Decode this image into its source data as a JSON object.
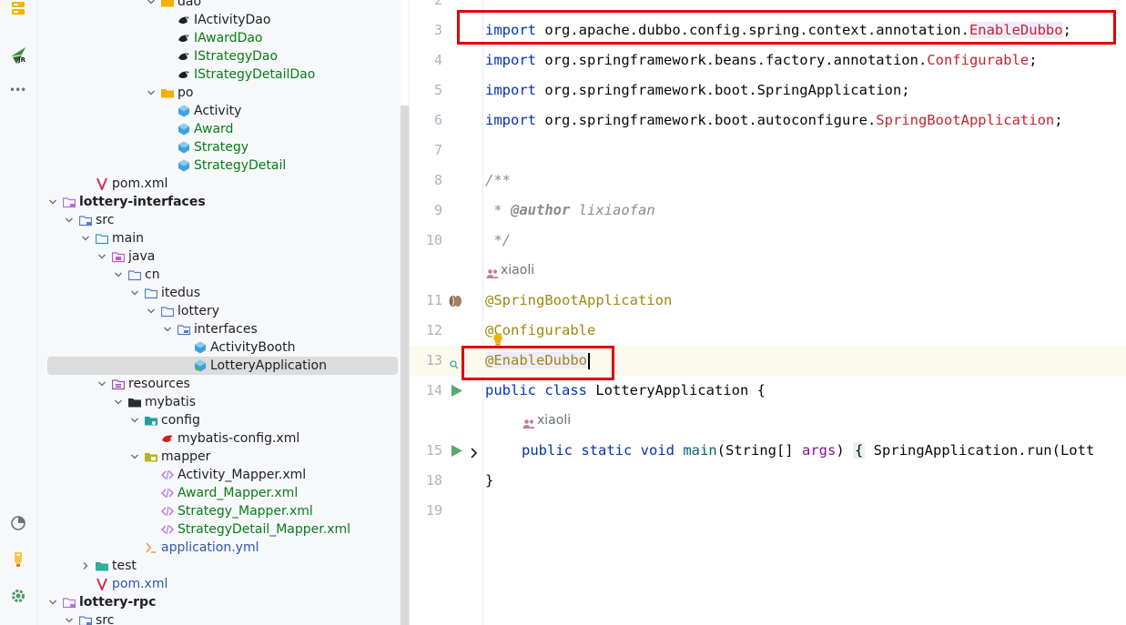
{
  "activity_bar": {
    "icons": [
      "structure-icon",
      "jrebel-icon",
      "more-icon",
      "profiler-icon",
      "notifications-icon",
      "settings-icon"
    ],
    "more_label": "•••",
    "jr_label": "JR"
  },
  "tree": {
    "rows": [
      {
        "label": "dao",
        "indent": 7,
        "icon": "folder",
        "arrow": "down",
        "color": "normal"
      },
      {
        "label": "IActivityDao",
        "indent": 8,
        "icon": "mybatis",
        "arrow": "",
        "color": "normal"
      },
      {
        "label": "IAwardDao",
        "indent": 8,
        "icon": "mybatis",
        "arrow": "",
        "color": "green"
      },
      {
        "label": "IStrategyDao",
        "indent": 8,
        "icon": "mybatis",
        "arrow": "",
        "color": "green"
      },
      {
        "label": "IStrategyDetailDao",
        "indent": 8,
        "icon": "mybatis",
        "arrow": "",
        "color": "green"
      },
      {
        "label": "po",
        "indent": 7,
        "icon": "folder",
        "arrow": "down",
        "color": "normal"
      },
      {
        "label": "Activity",
        "indent": 8,
        "icon": "class",
        "arrow": "",
        "color": "normal"
      },
      {
        "label": "Award",
        "indent": 8,
        "icon": "class",
        "arrow": "",
        "color": "green"
      },
      {
        "label": "Strategy",
        "indent": 8,
        "icon": "class",
        "arrow": "",
        "color": "green"
      },
      {
        "label": "StrategyDetail",
        "indent": 8,
        "icon": "class",
        "arrow": "",
        "color": "green"
      },
      {
        "label": "pom.xml",
        "indent": 3,
        "icon": "maven",
        "arrow": "",
        "color": "normal"
      },
      {
        "label": "lottery-interfaces",
        "indent": 1,
        "icon": "module",
        "arrow": "down",
        "color": "bold"
      },
      {
        "label": "src",
        "indent": 2,
        "icon": "srcfolder",
        "arrow": "down",
        "color": "normal"
      },
      {
        "label": "main",
        "indent": 3,
        "icon": "mainfolder",
        "arrow": "down",
        "color": "normal"
      },
      {
        "label": "java",
        "indent": 4,
        "icon": "javafolder",
        "arrow": "down",
        "color": "normal"
      },
      {
        "label": "cn",
        "indent": 5,
        "icon": "pkg",
        "arrow": "down",
        "color": "normal"
      },
      {
        "label": "itedus",
        "indent": 6,
        "icon": "pkg",
        "arrow": "down",
        "color": "normal"
      },
      {
        "label": "lottery",
        "indent": 7,
        "icon": "pkg",
        "arrow": "down",
        "color": "normal"
      },
      {
        "label": "interfaces",
        "indent": 8,
        "icon": "pkgsrc",
        "arrow": "down",
        "color": "normal"
      },
      {
        "label": "ActivityBooth",
        "indent": 9,
        "icon": "class",
        "arrow": "",
        "color": "normal"
      },
      {
        "label": "LotteryApplication",
        "indent": 9,
        "icon": "springclass",
        "arrow": "",
        "color": "normal",
        "selected": true
      },
      {
        "label": "resources",
        "indent": 4,
        "icon": "resfolder",
        "arrow": "down",
        "color": "normal"
      },
      {
        "label": "mybatis",
        "indent": 5,
        "icon": "darkfolder",
        "arrow": "down",
        "color": "normal"
      },
      {
        "label": "config",
        "indent": 6,
        "icon": "tealfolder",
        "arrow": "down",
        "color": "normal"
      },
      {
        "label": "mybatis-config.xml",
        "indent": 7,
        "icon": "mybatisxml",
        "arrow": "",
        "color": "normal"
      },
      {
        "label": "mapper",
        "indent": 6,
        "icon": "olivefolder",
        "arrow": "down",
        "color": "normal"
      },
      {
        "label": "Activity_Mapper.xml",
        "indent": 7,
        "icon": "xml",
        "arrow": "",
        "color": "normal"
      },
      {
        "label": "Award_Mapper.xml",
        "indent": 7,
        "icon": "xml",
        "arrow": "",
        "color": "green"
      },
      {
        "label": "Strategy_Mapper.xml",
        "indent": 7,
        "icon": "xml",
        "arrow": "",
        "color": "green"
      },
      {
        "label": "StrategyDetail_Mapper.xml",
        "indent": 7,
        "icon": "xml",
        "arrow": "",
        "color": "green"
      },
      {
        "label": "application.yml",
        "indent": 6,
        "icon": "yml",
        "arrow": "",
        "color": "blue"
      },
      {
        "label": "test",
        "indent": 3,
        "icon": "testfolder",
        "arrow": "right",
        "color": "normal"
      },
      {
        "label": "pom.xml",
        "indent": 3,
        "icon": "maven",
        "arrow": "",
        "color": "blue"
      },
      {
        "label": "lottery-rpc",
        "indent": 1,
        "icon": "module",
        "arrow": "down",
        "color": "bold"
      },
      {
        "label": "src",
        "indent": 2,
        "icon": "srcfolder",
        "arrow": "down",
        "color": "normal"
      }
    ]
  },
  "editor": {
    "line_numbers": [
      "2",
      "3",
      "4",
      "5",
      "6",
      "7",
      "8",
      "9",
      "10",
      "",
      "11",
      "12",
      "13",
      "14",
      "",
      "15",
      "18",
      "19"
    ],
    "import_kw": "import",
    "imports": [
      {
        "pkg": "org.apache.dubbo.config.spring.context.annotation.",
        "cls": "EnableDubbo",
        "end": ";"
      },
      {
        "pkg": "org.springframework.beans.factory.annotation.",
        "cls": "Configurable",
        "end": ";"
      },
      {
        "pkg": "org.springframework.boot.SpringApplication;",
        "cls": "",
        "end": ""
      },
      {
        "pkg": "org.springframework.boot.autoconfigure.",
        "cls": "SpringBootApplication",
        "end": ";"
      }
    ],
    "doc_open": "/**",
    "doc_author_prefix": " * ",
    "doc_author_tag": "@author",
    "doc_author_name": " lixiaofan",
    "doc_close": " */",
    "author_hint": "xiaoli",
    "anno1": "@SpringBootApplication",
    "anno2": "@Configurable",
    "anno3": "@EnableDubbo",
    "class_decl_kw": "public class",
    "class_name": " LotteryApplication {",
    "method_hint": "xiaoli",
    "method_kw": "public static void",
    "method_name": "main",
    "method_params_a": "(String[] ",
    "method_param_name": "args",
    "method_params_b": ") ",
    "method_body_open": "{",
    "method_body": " SpringApplication.run(Lott",
    "closing_brace": "}"
  }
}
